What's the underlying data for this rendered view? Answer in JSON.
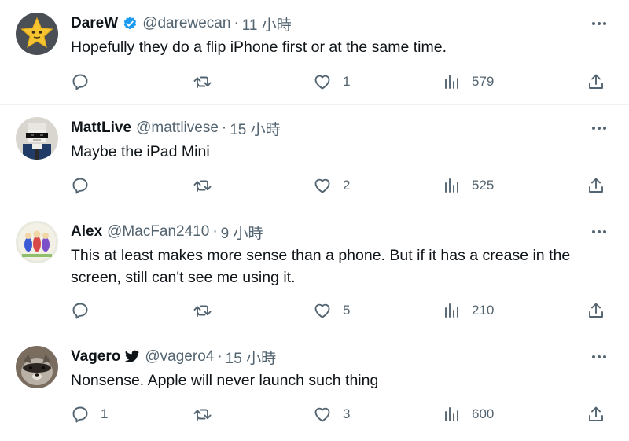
{
  "colors": {
    "text": "#0f1419",
    "secondary": "#536471",
    "verified": "#1d9bf0",
    "divider": "#eff3f4"
  },
  "tweets": [
    {
      "avatar_icon": "star-avatar-icon",
      "name": "DareW",
      "badge_icon": "verified-badge-icon",
      "handle": "@darewecan",
      "separator": "·",
      "time": "11 小時",
      "text": "Hopefully they do a flip iPhone first or at the same time.",
      "replies": "",
      "retweets": "",
      "likes": "1",
      "views": "579"
    },
    {
      "avatar_icon": "pixel-sunglasses-avatar-icon",
      "name": "MattLive",
      "badge_icon": "",
      "handle": "@mattlivese",
      "separator": "·",
      "time": "15 小時",
      "text": "Maybe the iPad Mini",
      "replies": "",
      "retweets": "",
      "likes": "2",
      "views": "525"
    },
    {
      "avatar_icon": "figures-avatar-icon",
      "name": "Alex",
      "badge_icon": "",
      "handle": "@MacFan2410",
      "separator": "·",
      "time": "9 小時",
      "text": "This at least makes more sense than a phone. But if it has a crease in the screen, still can't see me using it.",
      "replies": "",
      "retweets": "",
      "likes": "5",
      "views": "210"
    },
    {
      "avatar_icon": "raccoon-avatar-icon",
      "name": "Vagero",
      "badge_icon": "bird-badge-icon",
      "handle": "@vagero4",
      "separator": "·",
      "time": "15 小時",
      "text": "Nonsense. Apple will never launch such thing",
      "replies": "1",
      "retweets": "",
      "likes": "3",
      "views": "600"
    }
  ]
}
